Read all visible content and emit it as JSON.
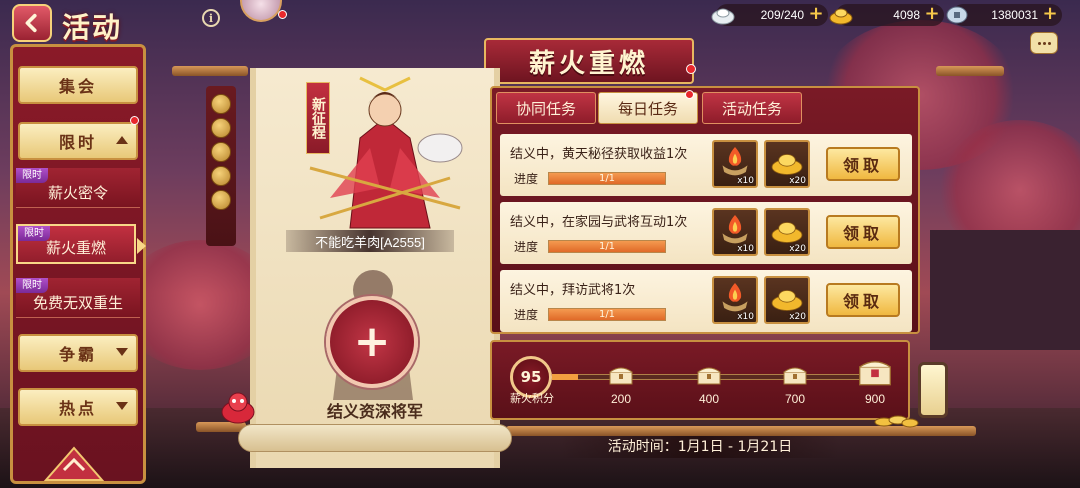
{
  "header": {
    "title": "活动",
    "info_symbol": "i"
  },
  "resources": [
    {
      "icon": "silver-ingot-icon",
      "value": "209/240"
    },
    {
      "icon": "gold-ingot-icon",
      "value": "4098"
    },
    {
      "icon": "coin-icon",
      "value": "1380031"
    }
  ],
  "sidebar": {
    "items": [
      {
        "label": "集会",
        "type": "category"
      },
      {
        "label": "限时",
        "type": "category",
        "expanded": true
      },
      {
        "label": "薪火密令",
        "tag": "限时"
      },
      {
        "label": "薪火重燃",
        "tag": "限时",
        "active": true
      },
      {
        "label": "免费无双重生",
        "tag": "限时"
      },
      {
        "label": "争霸",
        "type": "category"
      },
      {
        "label": "热点",
        "type": "category"
      }
    ]
  },
  "event": {
    "title": "薪火重燃",
    "hero_tag": "新征程",
    "hero_name": "不能吃羊肉[A2555]",
    "empty_slot_label": "结义资深将军",
    "add_symbol": "+",
    "time_label": "活动时间：1月1日 - 1月21日"
  },
  "tabs": [
    {
      "label": "协同任务",
      "active": false
    },
    {
      "label": "每日任务",
      "active": true
    },
    {
      "label": "活动任务",
      "active": false
    }
  ],
  "tasks": [
    {
      "title": "结义中，黄天秘径获取收益1次",
      "progress_label": "进度",
      "progress_text": "1/1",
      "progress": 1.0,
      "rewards": [
        {
          "icon": "fire-bowl-icon",
          "count": "x10"
        },
        {
          "icon": "gold-ingot-icon",
          "count": "x20"
        }
      ],
      "claim_label": "领取"
    },
    {
      "title": "结义中，在家园与武将互动1次",
      "progress_label": "进度",
      "progress_text": "1/1",
      "progress": 1.0,
      "rewards": [
        {
          "icon": "fire-bowl-icon",
          "count": "x10"
        },
        {
          "icon": "gold-ingot-icon",
          "count": "x20"
        }
      ],
      "claim_label": "领取"
    },
    {
      "title": "结义中，拜访武将1次",
      "progress_label": "进度",
      "progress_text": "1/1",
      "progress": 1.0,
      "rewards": [
        {
          "icon": "fire-bowl-icon",
          "count": "x10"
        },
        {
          "icon": "gold-ingot-icon",
          "count": "x20"
        }
      ],
      "claim_label": "领取"
    }
  ],
  "points": {
    "value": "95",
    "label": "薪火积分",
    "progress": 0.08,
    "milestones": [
      "200",
      "400",
      "700",
      "900"
    ]
  },
  "colors": {
    "accent_red": "#8a1a28",
    "gold_border": "#c89040",
    "progress_fill": "#e06a28"
  }
}
